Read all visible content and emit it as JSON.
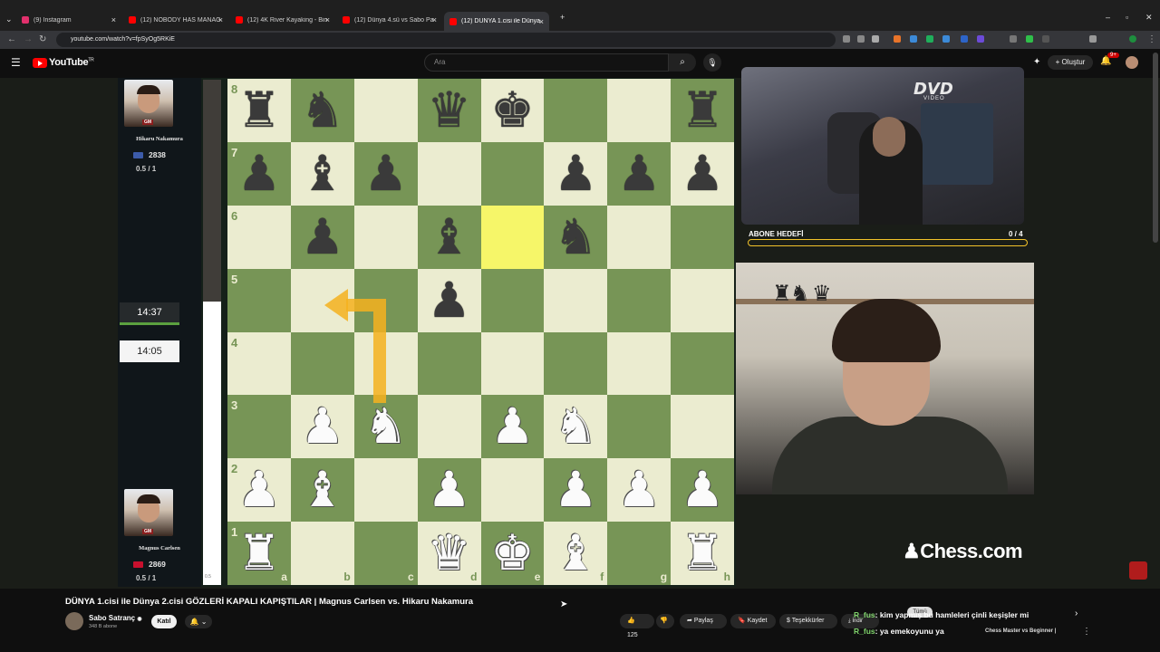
{
  "browser": {
    "tabs": [
      {
        "label": "(9) Instagram",
        "color": "#e1306c"
      },
      {
        "label": "(12) NOBODY HAS MANAGED",
        "color": "#ff0000"
      },
      {
        "label": "(12) 4K River Kayaking - Birds S",
        "color": "#ff0000"
      },
      {
        "label": "(12) Dünya 4.sü vs Sabo Paşa |",
        "color": "#ff0000"
      },
      {
        "label": "(12) DÜNYA 1.cisi ile Dünya 2.ci",
        "color": "#ff0000"
      }
    ],
    "new_tab": "+",
    "url": "youtube.com/watch?v=fpSyOg5RKiE"
  },
  "youtube": {
    "brand": "YouTube",
    "brand_sup": "TR",
    "search_placeholder": "Ara",
    "create_label": "Oluştur",
    "notifications": "9+"
  },
  "video": {
    "top_player": {
      "name": "Hikaru Nakamura",
      "rating": "2838",
      "score": "0.5 / 1",
      "title": "GM",
      "flag_color": "#3c5ba9"
    },
    "bottom_player": {
      "name": "Magnus Carlsen",
      "rating": "2869",
      "score": "0.5 / 1",
      "title": "GM",
      "flag_color": "#c8102e"
    },
    "clock_top": "14:37",
    "clock_bottom": "14:05",
    "eval": "0.5",
    "ranks": [
      "8",
      "7",
      "6",
      "5",
      "4",
      "3",
      "2",
      "1"
    ],
    "files": [
      "a",
      "b",
      "c",
      "d",
      "e",
      "f",
      "g",
      "h"
    ],
    "board": [
      [
        "br",
        "bn",
        "",
        "bq",
        "bk",
        "",
        "",
        "br"
      ],
      [
        "bp",
        "bb",
        "bp",
        "",
        "",
        "bp",
        "bp",
        "bp"
      ],
      [
        "",
        "bp",
        "",
        "bb",
        "",
        "bn",
        "",
        ""
      ],
      [
        "",
        "",
        "",
        "bp",
        "",
        "",
        "",
        ""
      ],
      [
        "",
        "",
        "",
        "",
        "",
        "",
        "",
        ""
      ],
      [
        "",
        "wp",
        "wn",
        "",
        "wp",
        "wn",
        "",
        ""
      ],
      [
        "wp",
        "wb",
        "",
        "wp",
        "",
        "wp",
        "wp",
        "wp"
      ],
      [
        "wr",
        "",
        "",
        "wq",
        "wk",
        "wb",
        "",
        "wr"
      ]
    ],
    "highlight_squares": [
      "e6"
    ],
    "dvd_logo": "DVD",
    "dvd_sub": "VIDEO",
    "goal_label": "ABONE HEDEFİ",
    "goal_count": "0 / 4",
    "chesscom_logo": "Chess.com"
  },
  "meta": {
    "title": "DÜNYA 1.cisi ile Dünya 2.cisi GÖZLERİ KAPALI KAPIŞTILAR | Magnus Carlsen vs. Hikaru Nakamura",
    "channel": "Sabo Satranç",
    "subscribers": "348 B abone",
    "join": "Katıl",
    "likes": "125",
    "share": "Paylaş",
    "save": "Kaydet",
    "thanks": "Teşekkürler",
    "download": "İndir"
  },
  "chat": [
    {
      "user": "R_fus",
      "text": ": kim yapmış bu hamleleri çinli keşişler mi"
    },
    {
      "user": "R_fus",
      "text": ": ya emekoyunu ya"
    }
  ],
  "recommend": {
    "chip": "Tümü",
    "title": "Chess Master vs Beginner |"
  }
}
